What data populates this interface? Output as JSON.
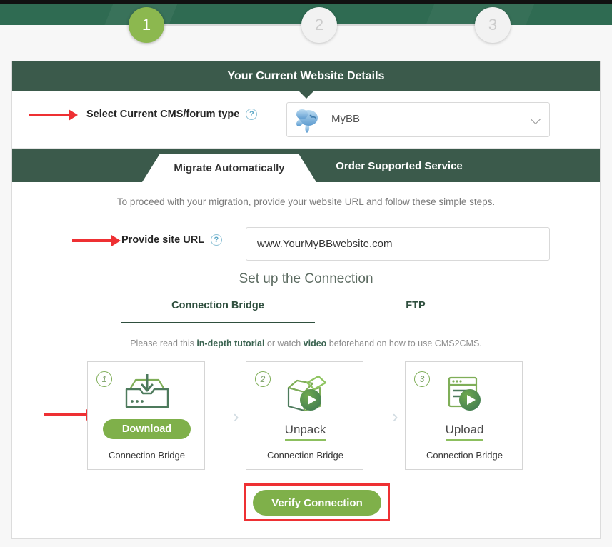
{
  "stepper": {
    "steps": [
      {
        "label": "1",
        "state": "active"
      },
      {
        "label": "2",
        "state": "inactive"
      },
      {
        "label": "3",
        "state": "inactive"
      }
    ]
  },
  "card": {
    "header_title": "Your Current Website Details"
  },
  "cms": {
    "label": "Select Current CMS/forum type",
    "help": "?",
    "selected": "MyBB",
    "logo_icon": "mybb-logo-icon",
    "chevron_icon": "chevron-down-icon"
  },
  "tabs": [
    {
      "label": "Migrate Automatically",
      "active": true
    },
    {
      "label": "Order Supported Service",
      "active": false
    }
  ],
  "pane": {
    "intro": "To proceed with your migration, provide your website URL and follow these simple steps.",
    "url_label": "Provide site URL",
    "url_help": "?",
    "url_value": "www.YourMyBBwebsite.com",
    "url_placeholder": "www.YourMyBBwebsite.com",
    "section_title": "Set up the Connection"
  },
  "subtabs": [
    {
      "label": "Connection Bridge",
      "active": true
    },
    {
      "label": "FTP",
      "active": false
    }
  ],
  "tutorial": {
    "part1": "Please read this ",
    "link1": "in-depth tutorial",
    "part2": " or watch ",
    "link2": "video",
    "part3": " beforehand on how to use CMS2CMS."
  },
  "step_cards": [
    {
      "number": "1",
      "icon": "download-tray-icon",
      "action": "Download",
      "action_style": "button",
      "caption": "Connection Bridge"
    },
    {
      "number": "2",
      "icon": "open-box-play-icon",
      "action": "Unpack",
      "action_style": "link",
      "caption": "Connection Bridge"
    },
    {
      "number": "3",
      "icon": "browser-window-play-icon",
      "action": "Upload",
      "action_style": "link",
      "caption": "Connection Bridge"
    }
  ],
  "separators": {
    "chevron": "›"
  },
  "verify": {
    "label": "Verify Connection",
    "highlighted": true
  },
  "colors": {
    "header_green": "#3b5a4b",
    "top_green": "#2f6b52",
    "accent_green": "#7fb04a",
    "step_active": "#8cb84f",
    "annotation_red": "#ee3033",
    "help_blue": "#5ba7c6"
  }
}
